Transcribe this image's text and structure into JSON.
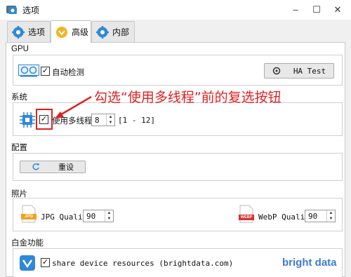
{
  "window": {
    "title": "选项",
    "minimize": "–",
    "maximize": "☐",
    "close": "✕"
  },
  "tabs": [
    {
      "label": "选项",
      "icon": "gear-icon"
    },
    {
      "label": "高级",
      "icon": "shield-badge-icon",
      "active": true
    },
    {
      "label": "内部",
      "icon": "gear-icon"
    }
  ],
  "gpu": {
    "section": "GPU",
    "auto_detect_label": "自动检测",
    "auto_detect_checked": "✓",
    "ha_test_label": "HA Test"
  },
  "system": {
    "section": "系统",
    "multithread_checked": "✓",
    "multithread_label": "使用多线程",
    "thread_count": "8",
    "thread_range": "[1 - 12]"
  },
  "config": {
    "section": "配置",
    "reset_label": "重设"
  },
  "photo": {
    "section": "照片",
    "jpg_badge": "JPG",
    "jpg_label": "JPG Quality",
    "jpg_value": "90",
    "webp_badge": "WEBP",
    "webp_label": "WebP Quality",
    "webp_value": "90"
  },
  "platinum": {
    "section": "白金功能",
    "share_checked": "✓",
    "share_label": "share device resources (brightdata.com)",
    "brand_logo": "bright data"
  },
  "annotation": {
    "text": "勾选“使用多线程”前的复选按钮"
  },
  "colors": {
    "accent": "#e02020",
    "brightdata": "#3e7bd6"
  }
}
